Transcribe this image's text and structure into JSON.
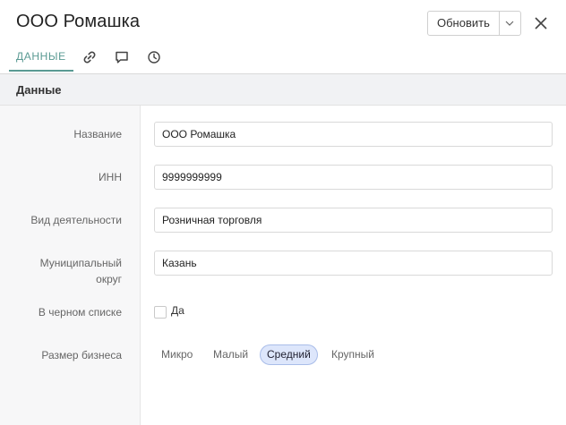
{
  "header": {
    "title": "ООО Ромашка",
    "update_label": "Обновить",
    "dropdown_icon": "chevron-down-icon",
    "close_icon": "close-icon"
  },
  "tabs": [
    {
      "label": "ДАННЫЕ",
      "active": true
    },
    {
      "icon": "link-icon"
    },
    {
      "icon": "comment-icon"
    },
    {
      "icon": "history-icon"
    }
  ],
  "section": {
    "title": "Данные"
  },
  "fields": {
    "name": {
      "label": "Название",
      "value": "ООО Ромашка"
    },
    "inn": {
      "label": "ИНН",
      "value": "9999999999"
    },
    "activity": {
      "label": "Вид деятельности",
      "value": "Розничная торговля"
    },
    "district": {
      "label_line1": "Муниципальный",
      "label_line2": "округ",
      "value": "Казань"
    },
    "blacklist": {
      "label": "В черном списке",
      "checkbox_label": "Да",
      "checked": false
    },
    "business_size": {
      "label": "Размер бизнеса",
      "options": [
        "Микро",
        "Малый",
        "Средний",
        "Крупный"
      ],
      "selected": "Средний"
    }
  },
  "colors": {
    "accent": "#5a9a93",
    "selected_bg": "#dde6fb",
    "selected_border": "#a9bde9"
  }
}
